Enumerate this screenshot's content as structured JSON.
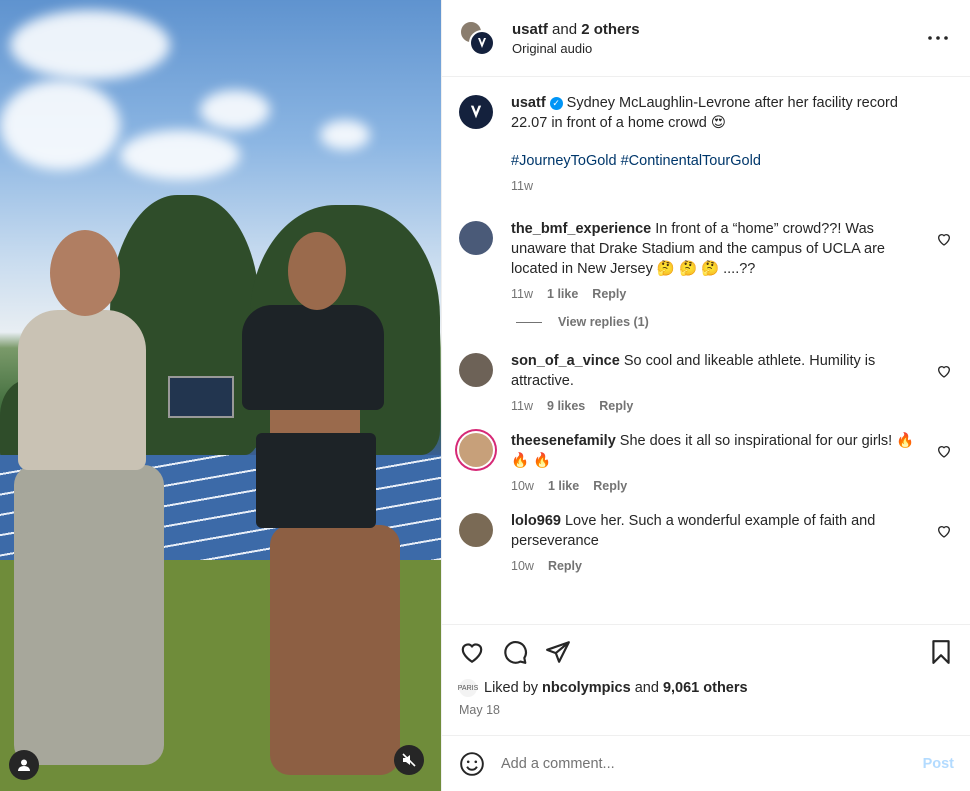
{
  "header": {
    "author": "usatf",
    "and_text": "and",
    "others": "2 others",
    "audio": "Original audio",
    "more_icon": "more-horizontal-icon"
  },
  "caption": {
    "username": "usatf",
    "text": "Sydney McLaughlin-Levrone after her facility record 22.07 in front of a home crowd 😍",
    "hashtags": "#JourneyToGold #ContinentalTourGold",
    "time": "11w"
  },
  "comments": [
    {
      "username": "the_bmf_experience",
      "text": "In front of a “home” crowd??! Was unaware that Drake Stadium and the campus of UCLA are located in New Jersey 🤔 🤔 🤔 ....??",
      "time": "11w",
      "likes": "1 like",
      "reply": "Reply",
      "avatar_color": "#4a5a78"
    },
    {
      "username": "son_of_a_vince",
      "text": "So cool and likeable athlete. Humility is attractive.",
      "time": "11w",
      "likes": "9 likes",
      "reply": "Reply",
      "avatar_color": "#6d6257"
    },
    {
      "username": "theesenefamily",
      "text": "She does it all so inspirational for our girls! 🔥 🔥 🔥",
      "time": "10w",
      "likes": "1 like",
      "reply": "Reply",
      "avatar_color": "#c7a07a"
    },
    {
      "username": "lolo969",
      "text": "Love her. Such a wonderful example of faith and perseverance",
      "time": "10w",
      "reply": "Reply",
      "avatar_color": "#7a6a55"
    }
  ],
  "view_replies": "View replies (1)",
  "likes_line": {
    "prefix": "Liked by",
    "by_user": "nbcolympics",
    "and_text": "and",
    "count": "9,061 others",
    "badge": "PARIS"
  },
  "date": "May 18",
  "composer": {
    "placeholder": "Add a comment...",
    "post_label": "Post"
  },
  "colors": {
    "text": "#262626",
    "muted": "#737373",
    "hashtag": "#00376b",
    "verified": "#0095f6",
    "post_disabled": "#b3dbff"
  }
}
